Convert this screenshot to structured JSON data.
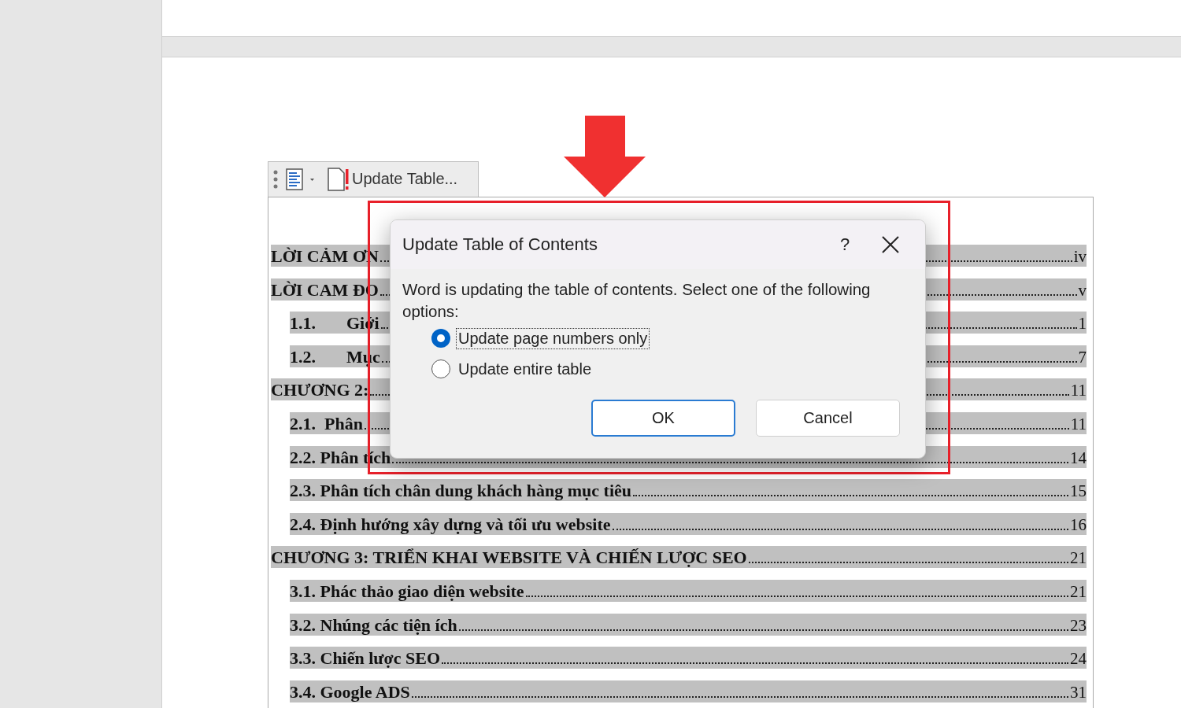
{
  "toc_toolbar": {
    "update_button": "Update Table..."
  },
  "toc_entries": [
    {
      "kind": "chapter",
      "label": "LỜI CẢM ƠN",
      "page": "iv"
    },
    {
      "kind": "chapter",
      "label": "LỜI CAM ĐO",
      "page": "v"
    },
    {
      "kind": "section",
      "number": "1.1.",
      "label": "Giới",
      "page": "1"
    },
    {
      "kind": "section",
      "number": "1.2.",
      "label": "Mục",
      "page": "7"
    },
    {
      "kind": "chapter",
      "label": "CHƯƠNG 2:",
      "page": "11"
    },
    {
      "kind": "section",
      "label": "2.1.  Phân",
      "page": "11"
    },
    {
      "kind": "section",
      "label": "2.2. Phân tích",
      "page": "14"
    },
    {
      "kind": "section",
      "label": "2.3. Phân tích chân dung khách hàng mục tiêu",
      "page": "15"
    },
    {
      "kind": "section",
      "label": "2.4. Định hướng xây dựng và tối ưu website",
      "page": "16"
    },
    {
      "kind": "chapter",
      "label": "CHƯƠNG 3: TRIỂN KHAI WEBSITE VÀ CHIẾN LƯỢC SEO",
      "page": "21"
    },
    {
      "kind": "section",
      "label": "3.1. Phác thảo giao diện website",
      "page": "21"
    },
    {
      "kind": "section",
      "label": "3.2. Nhúng các tiện ích",
      "page": "23"
    },
    {
      "kind": "section",
      "label": "3.3. Chiến lược SEO",
      "page": "24"
    },
    {
      "kind": "section",
      "label": "3.4. Google ADS",
      "page": "31"
    }
  ],
  "dialog": {
    "title": "Update Table of Contents",
    "help": "?",
    "message": "Word is updating the table of contents.  Select one of the following options:",
    "options": [
      {
        "label": "Update page numbers only",
        "selected": true
      },
      {
        "label": "Update entire table",
        "selected": false
      }
    ],
    "buttons": [
      {
        "label": "OK",
        "kind": "default"
      },
      {
        "label": "Cancel",
        "kind": "normal"
      }
    ]
  }
}
